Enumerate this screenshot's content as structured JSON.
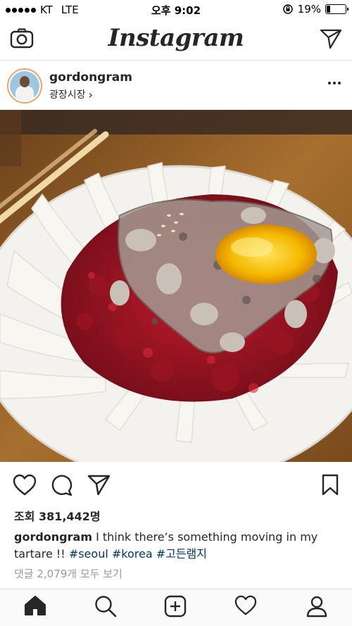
{
  "status_bar": {
    "carrier": "KT",
    "network": "LTE",
    "time": "오후 9:02",
    "battery_percent": "19%",
    "battery_level": 0.19
  },
  "header": {
    "logo": "Instagram",
    "camera_icon": "camera-icon",
    "direct_icon": "paper-plane-icon"
  },
  "post": {
    "username": "gordongram",
    "location": "광장시장",
    "location_chevron": "›",
    "views": "조회 381,442명",
    "caption_user": "gordongram",
    "caption_text": " I think there’s something moving in my tartare !! ",
    "caption_tags": "#seoul #korea #고든램지",
    "comments_link": "댓글 2,079개 모두 보기"
  },
  "actions": {
    "like_icon": "heart-icon",
    "comment_icon": "comment-icon",
    "share_icon": "paper-plane-icon",
    "save_icon": "bookmark-icon"
  },
  "tabbar": [
    "home-icon",
    "search-icon",
    "add-icon",
    "activity-icon",
    "profile-icon"
  ],
  "colors": {
    "text": "#262626",
    "hashtag": "#003569",
    "muted": "#999999",
    "border": "#dbdbdb",
    "avatar_ring": "#e9a36b"
  }
}
